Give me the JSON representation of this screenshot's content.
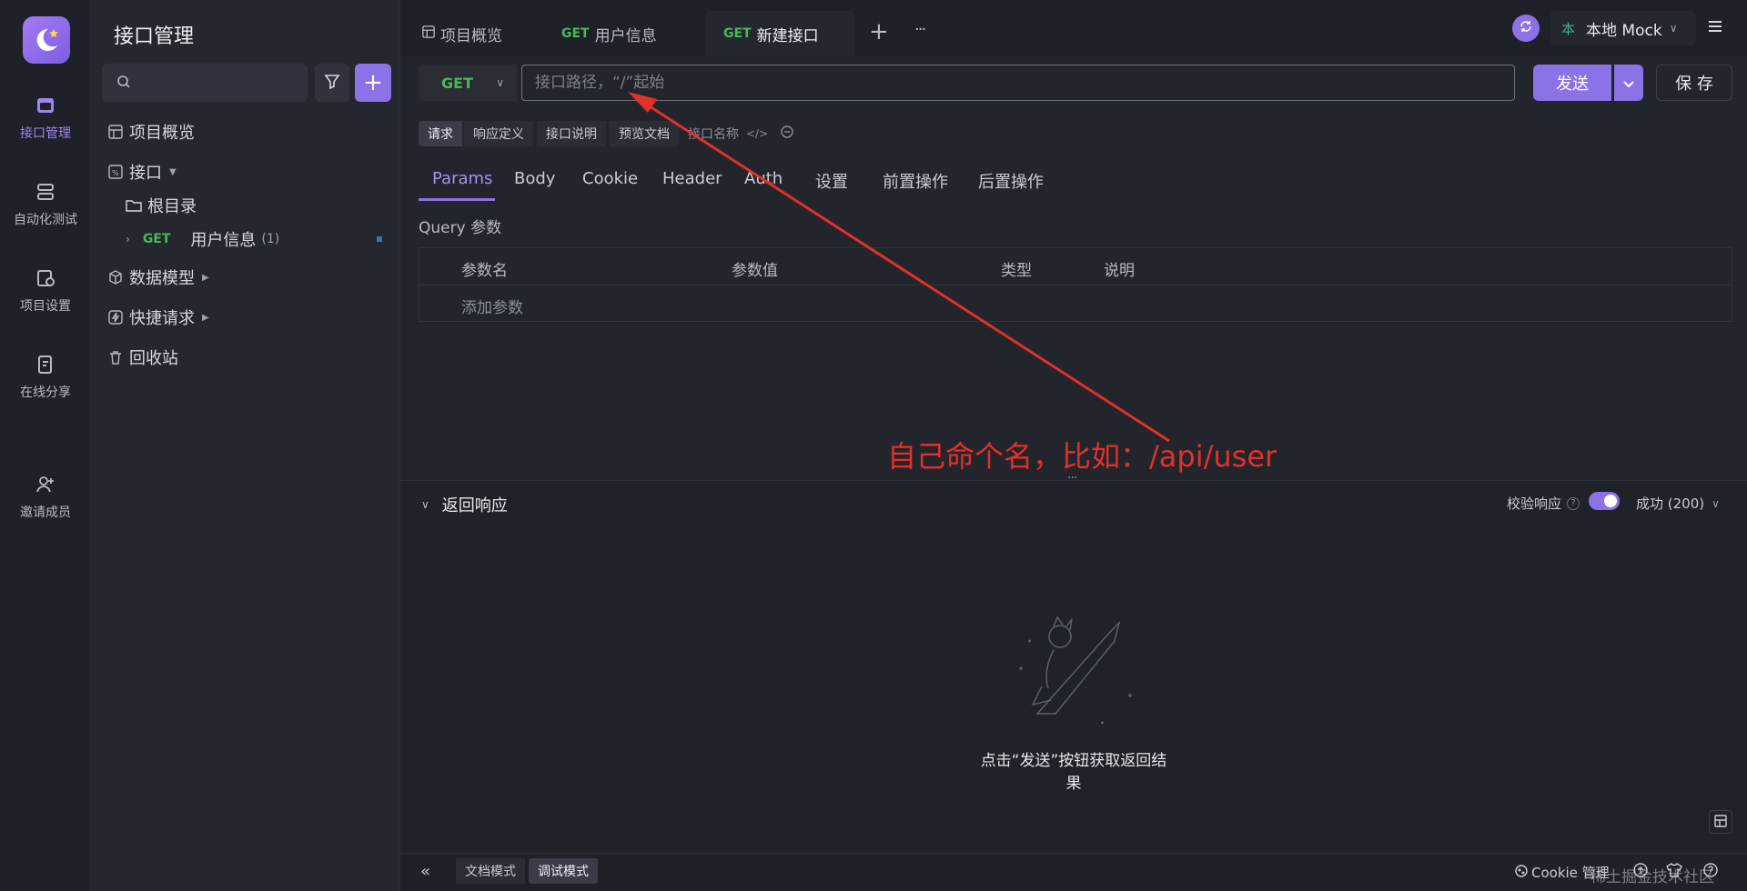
{
  "leftnav": {
    "items": [
      {
        "label": "接口管理",
        "icon": "api-management-icon",
        "active": true
      },
      {
        "label": "自动化测试",
        "icon": "automation-icon"
      },
      {
        "label": "项目设置",
        "icon": "project-settings-icon"
      },
      {
        "label": "在线分享",
        "icon": "share-icon"
      },
      {
        "label": "邀请成员",
        "icon": "invite-member-icon"
      }
    ]
  },
  "tree": {
    "title": "接口管理",
    "items": {
      "overview": "项目概览",
      "api": "接口",
      "root": "根目录",
      "endpoint_method": "GET",
      "endpoint_name": "用户信息",
      "endpoint_count": "(1)",
      "models": "数据模型",
      "quick": "快捷请求",
      "trash": "回收站"
    }
  },
  "tabs": {
    "overview": "项目概览",
    "tab1_method": "GET",
    "tab1_label": "用户信息",
    "tab2_method": "GET",
    "tab2_label": "新建接口",
    "add": "+",
    "more": "···"
  },
  "env": {
    "badge": "本",
    "label": "本地 Mock"
  },
  "request": {
    "method": "GET",
    "url_placeholder": "接口路径，“/”起始",
    "send": "发送",
    "save": "保 存"
  },
  "modes": {
    "request": "请求",
    "response_def": "响应定义",
    "api_doc": "接口说明",
    "preview": "预览文档",
    "name_hint": "接口名称"
  },
  "param_tabs": [
    "Params",
    "Body",
    "Cookie",
    "Header",
    "Auth",
    "设置",
    "前置操作",
    "后置操作"
  ],
  "query": {
    "title": "Query 参数",
    "headers": [
      "参数名",
      "参数值",
      "类型",
      "说明"
    ],
    "add": "添加参数"
  },
  "response": {
    "title": "返回响应",
    "validate": "校验响应",
    "status": "成功 (200)",
    "empty_hint": "点击“发送”按钮获取返回结果"
  },
  "bottom": {
    "doc_mode": "文档模式",
    "debug_mode": "调试模式",
    "cookie": "Cookie 管理",
    "watermark": "稀土掘金技术社区"
  },
  "annotation": {
    "text": "自己命个名，比如：/api/user",
    "color": "#e2302a"
  },
  "colors": {
    "accent": "#8b72e6",
    "get": "#48b85b"
  }
}
